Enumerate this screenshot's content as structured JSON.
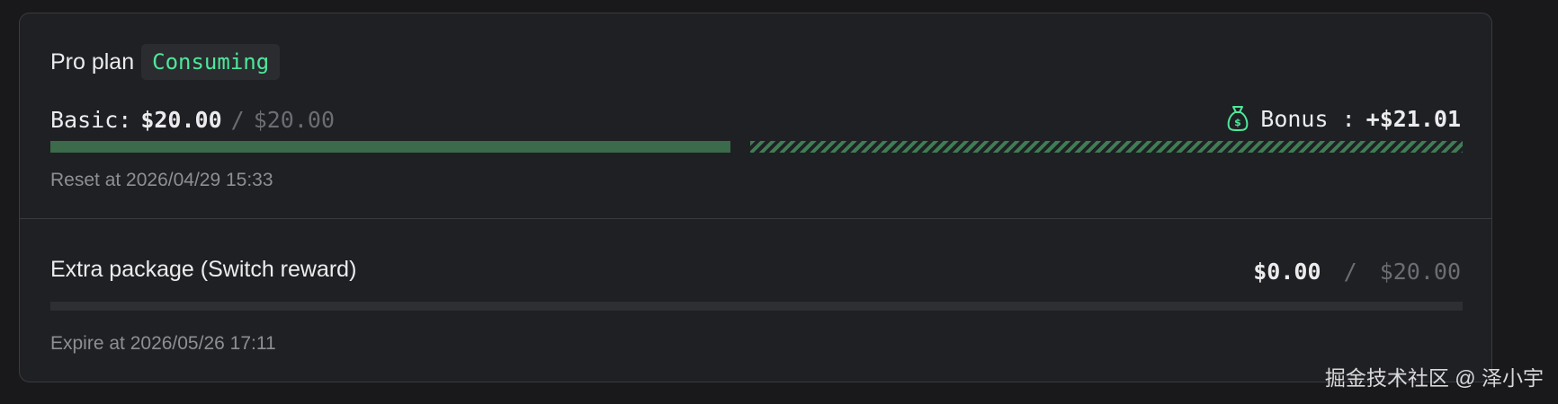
{
  "plan": {
    "title": "Pro plan",
    "status": "Consuming"
  },
  "basic": {
    "label": "Basic:",
    "used": "$20.00",
    "separator": "/",
    "total": "$20.00",
    "progress_fraction": 1.0,
    "reset_text": "Reset at 2026/04/29 15:33"
  },
  "bonus": {
    "icon": "money-bag-icon",
    "label": "Bonus :",
    "value": "+$21.01"
  },
  "extra": {
    "title": "Extra package (Switch reward)",
    "used": "$0.00",
    "separator": "/",
    "total": "$20.00",
    "progress_fraction": 0.0,
    "expire_text": "Expire at 2026/05/26 17:11"
  },
  "watermark": "掘金技术社区 @ 泽小宇",
  "colors": {
    "accent_green": "#4ee79a",
    "progress_green": "#3b6b4a",
    "background": "#19191b",
    "card": "#1f2023"
  }
}
